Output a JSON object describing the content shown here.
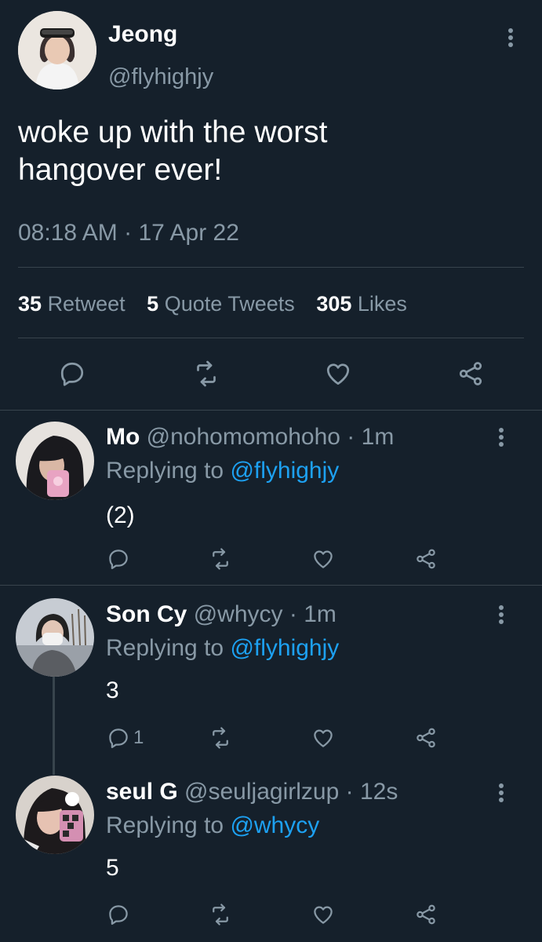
{
  "tweet": {
    "author_name": "Jeong",
    "author_handle": "@flyhighjy",
    "text": "woke up with the worst hangover ever!",
    "time": "08:18 AM",
    "sep": "·",
    "date": "17 Apr 22",
    "stats": {
      "retweets_count": "35",
      "retweets_label": "Retweet",
      "quotes_count": "5",
      "quotes_label": "Quote Tweets",
      "likes_count": "305",
      "likes_label": "Likes"
    }
  },
  "replies": [
    {
      "name": "Mo",
      "handle": "@nohomomohoho",
      "sep": "·",
      "time": "1m",
      "replying_label": "Replying to",
      "replying_to": "@flyhighjy",
      "text": "(2)",
      "reply_count": ""
    },
    {
      "name": "Son Cy",
      "handle": "@whycy",
      "sep": "·",
      "time": "1m",
      "replying_label": "Replying to",
      "replying_to": "@flyhighjy",
      "text": "3",
      "reply_count": "1"
    },
    {
      "name": "seul G",
      "handle": "@seuljagirlzup",
      "sep": "·",
      "time": "12s",
      "replying_label": "Replying to",
      "replying_to": "@whycy",
      "text": "5",
      "reply_count": ""
    }
  ],
  "icons": {
    "more": "more-vertical-icon",
    "reply": "reply-icon",
    "retweet": "retweet-icon",
    "like": "heart-icon",
    "share": "share-icon"
  },
  "colors": {
    "background": "#15202b",
    "text": "#ffffff",
    "muted": "#8899a6",
    "link": "#1da1f2",
    "divider": "#38444d"
  }
}
